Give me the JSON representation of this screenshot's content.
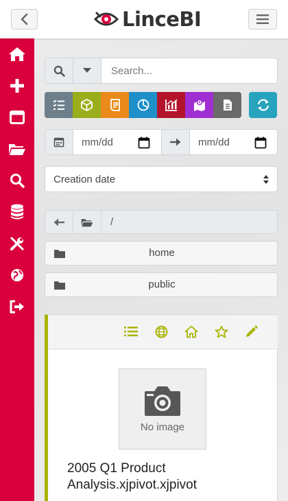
{
  "app": {
    "brand": "LinceBI"
  },
  "header": {
    "back_icon": "chevron-left-icon",
    "menu_icon": "hamburger-icon"
  },
  "sidebar": {
    "color": "#d9003d",
    "items": [
      {
        "name": "home",
        "icon": "home-icon"
      },
      {
        "name": "new",
        "icon": "plus-icon"
      },
      {
        "name": "window",
        "icon": "window-icon"
      },
      {
        "name": "browse",
        "icon": "folder-open-icon"
      },
      {
        "name": "search",
        "icon": "search-icon"
      },
      {
        "name": "database",
        "icon": "database-icon"
      },
      {
        "name": "tools",
        "icon": "tools-icon"
      },
      {
        "name": "globe",
        "icon": "globe-icon"
      },
      {
        "name": "logout",
        "icon": "sign-out-icon"
      }
    ]
  },
  "search": {
    "placeholder": "Search..."
  },
  "type_filters": [
    {
      "name": "list",
      "icon": "list-check-icon",
      "color": "#6d7f8b"
    },
    {
      "name": "cube",
      "icon": "cube-icon",
      "color": "#9aad1b"
    },
    {
      "name": "report",
      "icon": "report-icon",
      "color": "#ea8a1a"
    },
    {
      "name": "pie",
      "icon": "pie-chart-icon",
      "color": "#1f8fc9"
    },
    {
      "name": "chart",
      "icon": "bar-chart-icon",
      "color": "#b3142b"
    },
    {
      "name": "map",
      "icon": "map-icon",
      "color": "#a02fd2"
    },
    {
      "name": "document",
      "icon": "document-icon",
      "color": "#6a6a6a"
    },
    {
      "name": "refresh",
      "icon": "refresh-icon",
      "color": "#27a3bd"
    }
  ],
  "date_filter": {
    "from_placeholder": "mm/dd",
    "to_placeholder": "mm/dd"
  },
  "sort": {
    "selected": "Creation date"
  },
  "path": {
    "current": "/"
  },
  "folders": [
    {
      "label": "home"
    },
    {
      "label": "public"
    }
  ],
  "card": {
    "no_image_label": "No image",
    "title": "2005 Q1 Product Analysis.xjpivot.xjpivot",
    "accent_color": "#a8b400",
    "action_color": "#a8b400"
  }
}
